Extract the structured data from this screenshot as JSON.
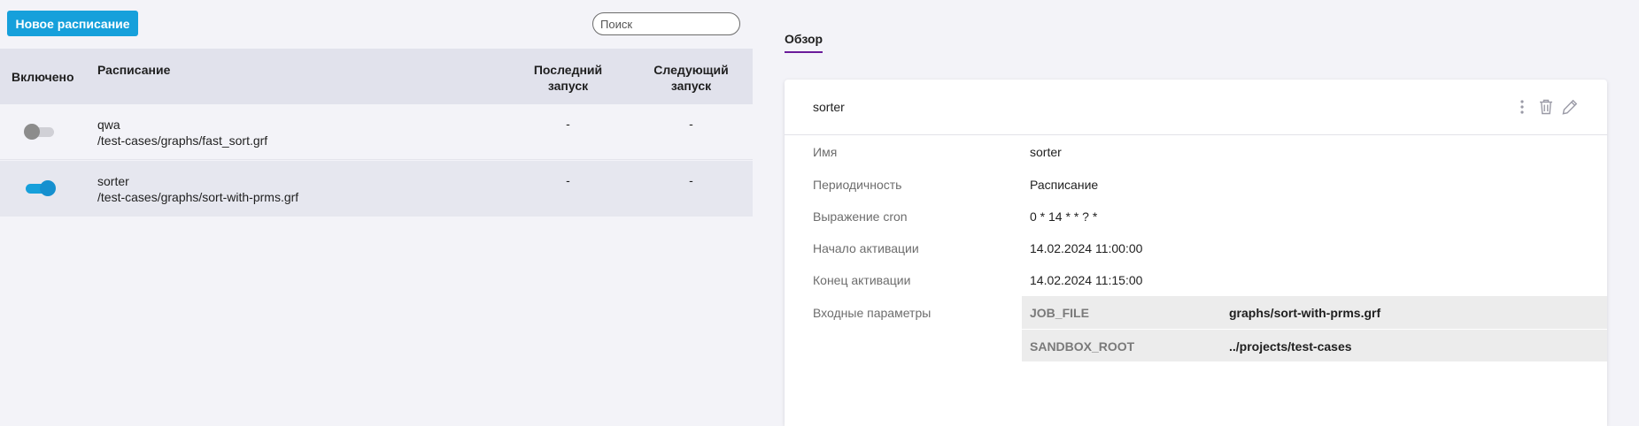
{
  "toolbar": {
    "new_schedule_label": "Новое расписание",
    "search_placeholder": "Поиск"
  },
  "table": {
    "headers": {
      "enabled": "Включено",
      "schedule": "Расписание",
      "last_run": "Последний запуск",
      "next_run": "Следующий запуск"
    },
    "rows": [
      {
        "enabled": false,
        "name": "qwa",
        "path": "/test-cases/graphs/fast_sort.grf",
        "last_run": "-",
        "next_run": "-"
      },
      {
        "enabled": true,
        "name": "sorter",
        "path": "/test-cases/graphs/sort-with-prms.grf",
        "last_run": "-",
        "next_run": "-"
      }
    ]
  },
  "details": {
    "tab_label": "Обзор",
    "title": "sorter",
    "fields": {
      "name_label": "Имя",
      "name_value": "sorter",
      "periodicity_label": "Периодичность",
      "periodicity_value": "Расписание",
      "cron_label": "Выражение cron",
      "cron_value": "0 * 14 * * ? *",
      "start_label": "Начало активации",
      "start_value": "14.02.2024 11:00:00",
      "end_label": "Конец активации",
      "end_value": "14.02.2024 11:15:00",
      "params_label": "Входные параметры"
    },
    "params": [
      {
        "key": "JOB_FILE",
        "value": "graphs/sort-with-prms.grf"
      },
      {
        "key": "SANDBOX_ROOT",
        "value": "../projects/test-cases"
      }
    ],
    "icons": [
      "more-vertical-icon",
      "trash-icon",
      "edit-pencil-icon"
    ]
  },
  "colors": {
    "primary": "#16a0db",
    "tab_underline": "#6a1b9a",
    "header_bg": "#e1e2ec",
    "selected_row_bg": "#e6e7ef"
  }
}
